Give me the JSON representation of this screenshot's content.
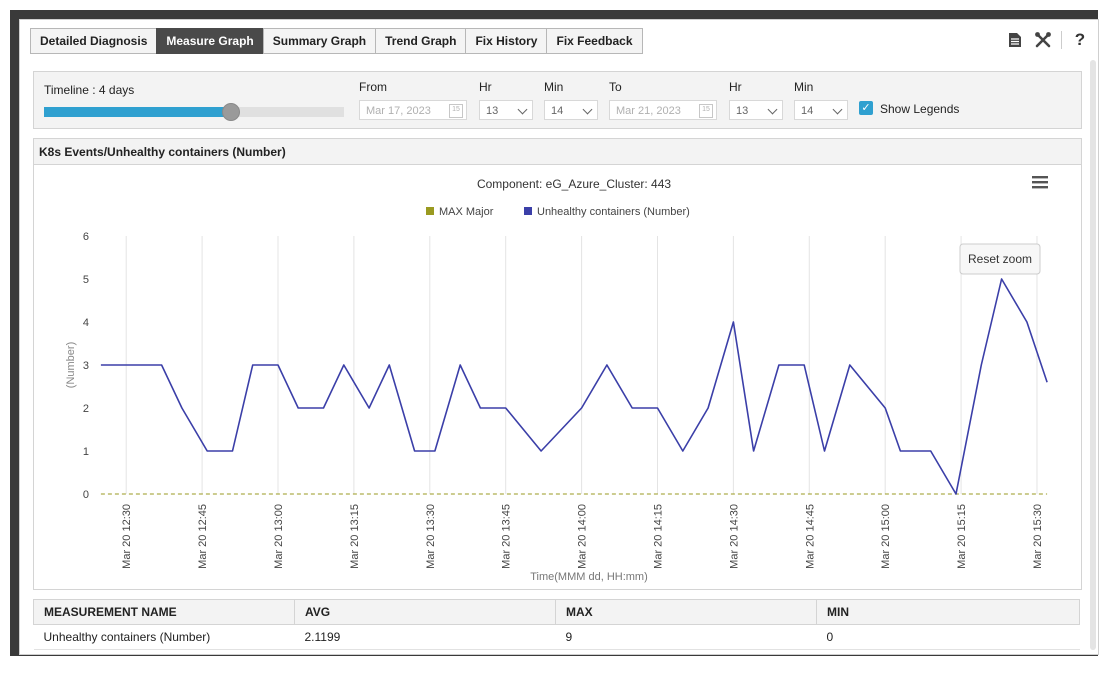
{
  "tabs": [
    {
      "label": "Detailed Diagnosis",
      "active": false
    },
    {
      "label": "Measure Graph",
      "active": true
    },
    {
      "label": "Summary Graph",
      "active": false
    },
    {
      "label": "Trend Graph",
      "active": false
    },
    {
      "label": "Fix History",
      "active": false
    },
    {
      "label": "Fix Feedback",
      "active": false
    }
  ],
  "toolbar": {
    "help_label": "?"
  },
  "timeline": {
    "label": "Timeline : 4 days",
    "slider_level": 0.62,
    "from_label": "From",
    "from_date": "Mar 17, 2023",
    "from_hr_label": "Hr",
    "from_hr": "13",
    "from_min_label": "Min",
    "from_min": "14",
    "to_label": "To",
    "to_date": "Mar 21, 2023",
    "to_hr_label": "Hr",
    "to_hr": "13",
    "to_min_label": "Min",
    "to_min": "14",
    "show_legends_label": "Show Legends",
    "show_legends": true,
    "calendar_glyph": "15"
  },
  "chart_panel": {
    "title": "K8s Events/Unhealthy containers (Number)",
    "reset_zoom": "Reset zoom"
  },
  "chart_data": {
    "type": "line",
    "title": "Component: eG_Azure_Cluster: 443",
    "xlabel": "Time(MMM dd, HH:mm)",
    "ylabel": "(Number)",
    "ylim": [
      0,
      6
    ],
    "yticks": [
      "0",
      "1",
      "2",
      "3",
      "4",
      "5",
      "6"
    ],
    "xlim_minutes": [
      12.417,
      15.533
    ],
    "xticks": [
      "Mar 20 12:30",
      "Mar 20 12:45",
      "Mar 20 13:00",
      "Mar 20 13:15",
      "Mar 20 13:30",
      "Mar 20 13:45",
      "Mar 20 14:00",
      "Mar 20 14:15",
      "Mar 20 14:30",
      "Mar 20 14:45",
      "Mar 20 15:00",
      "Mar 20 15:15",
      "Mar 20 15:30"
    ],
    "series": [
      {
        "name": "MAX Major",
        "color": "#9a9a20",
        "dashed": true,
        "x": [
          "12:25",
          "15:32"
        ],
        "values": [
          0,
          0
        ]
      },
      {
        "name": "Unhealthy containers (Number)",
        "color": "#3b3fa8",
        "x": [
          "12:25",
          "12:32",
          "12:37",
          "12:41",
          "12:46",
          "12:51",
          "12:55",
          "13:00",
          "13:04",
          "13:09",
          "13:13",
          "13:18",
          "13:22",
          "13:27",
          "13:31",
          "13:36",
          "13:40",
          "13:45",
          "13:52",
          "14:00",
          "14:05",
          "14:10",
          "14:15",
          "14:20",
          "14:25",
          "14:30",
          "14:34",
          "14:39",
          "14:44",
          "14:48",
          "14:53",
          "15:00",
          "15:03",
          "15:09",
          "15:14",
          "15:19",
          "15:23",
          "15:28",
          "15:32"
        ],
        "values": [
          3,
          3,
          3,
          2,
          1,
          1,
          3,
          3,
          2,
          2,
          3,
          2,
          3,
          1,
          1,
          3,
          2,
          2,
          1,
          2,
          3,
          2,
          2,
          1,
          2,
          4,
          1,
          3,
          3,
          1,
          3,
          2,
          1,
          1,
          0,
          3,
          5,
          4,
          2.6
        ]
      }
    ],
    "legend_position": "top-center",
    "grid": "vertical"
  },
  "stats_table": {
    "headers": [
      "MEASUREMENT NAME",
      "AVG",
      "MAX",
      "MIN"
    ],
    "rows": [
      [
        "Unhealthy containers (Number)",
        "2.1199",
        "9",
        "0"
      ]
    ]
  }
}
